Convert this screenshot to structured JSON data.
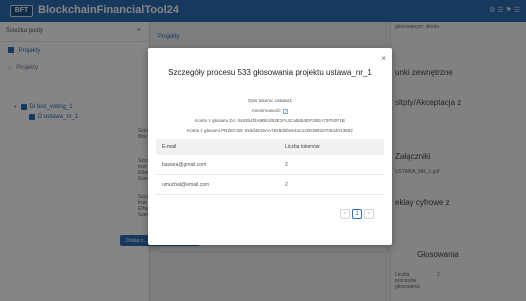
{
  "app": {
    "logo": "BFT",
    "title": "BlockchainFinancialTool24",
    "top_icons": "⚙ ☰ ⚑ ☰"
  },
  "sidebar": {
    "header": "Ścieżka posty",
    "items": [
      {
        "label": "Projekty",
        "icon": "folder-icon"
      },
      {
        "label": "Projekty",
        "icon": "home-icon"
      }
    ],
    "tree": [
      {
        "label": "Di test_voting_1"
      },
      {
        "label": "D ustawa_nr_1"
      }
    ]
  },
  "main": {
    "breadcrumb": "Projekty",
    "side_texts": [
      "Szcz Bloc",
      "Szcz tran Ethereum Szerk",
      "Szcz tran Ethereum Szerk"
    ],
    "process_button": "Dodaj n..."
  },
  "right_panel": {
    "top_note": "głosowanym: skrótu",
    "label1": "unki zewnętrzne",
    "label2": "sltpty/Akceptacja z",
    "label3": "Załączniki",
    "file_name": "USTAWA_NR_1.pdf",
    "label4": "eklay cyfrowe z",
    "label5": "Głosowania",
    "votes_label": "Liczba procesów głosowania",
    "votes_value": "2"
  },
  "modal": {
    "title": "Szczegóły procesu 533 głosowania projektu ustawa_nr_1",
    "token_desc": "Opis tokenu: ustawa1",
    "anonymous_label": "Anonimowość:",
    "anonymous_checked": true,
    "yes_account": "Konto z głosami ZA: 0x82b4f3A9B51f63E1Fc4Ca5b54DF20EA73F52F1B",
    "no_account": "Konto z głosami PRZECIW: 0x0d4616AA7828d0b0e41e12003891570544013552",
    "columns": [
      "E-mail",
      "Liczba tokenów"
    ],
    "rows": [
      {
        "email": "basiara@gmail.com",
        "tokens": "2"
      },
      {
        "email": "umuchat@email.com",
        "tokens": "2"
      }
    ],
    "pagination": {
      "prev": "‹",
      "current": "1",
      "next": "›"
    }
  }
}
